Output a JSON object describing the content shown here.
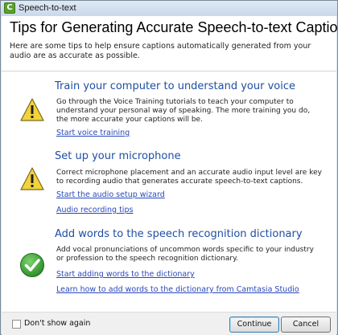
{
  "window": {
    "title": "Speech-to-text",
    "icon": "camtasia-app-icon"
  },
  "header": {
    "title": "Tips for Generating Accurate Speech-to-text Captions",
    "intro": "Here are some tips to help ensure captions automatically generated from your audio are as accurate as possible."
  },
  "sections": [
    {
      "icon": "warning-icon",
      "title": "Train your computer to understand your voice",
      "description": "Go through the Voice Training tutorials to teach your computer to understand your personal way of speaking. The more training you do, the more accurate your captions will be.",
      "links": [
        "Start voice training"
      ]
    },
    {
      "icon": "warning-icon",
      "title": "Set up your microphone",
      "description": "Correct microphone placement and an accurate audio input level are key to recording audio that generates accurate speech-to-text captions.",
      "links": [
        "Start the audio setup wizard",
        "Audio recording tips"
      ]
    },
    {
      "icon": "checkmark-icon",
      "title": "Add words to the speech recognition dictionary",
      "description": "Add vocal pronunciations of uncommon words specific to your industry or profession to the speech recognition dictionary.",
      "links": [
        "Start adding words to the dictionary",
        "Learn how to add words to the dictionary from Camtasia Studio"
      ]
    }
  ],
  "footer": {
    "dont_show_label": "Don't show again",
    "dont_show_checked": false,
    "continue_label": "Continue",
    "cancel_label": "Cancel"
  },
  "colors": {
    "section_title": "#1f4ea3",
    "link": "#2a48b8",
    "warning": "#f2d33a",
    "check": "#3aa537"
  }
}
